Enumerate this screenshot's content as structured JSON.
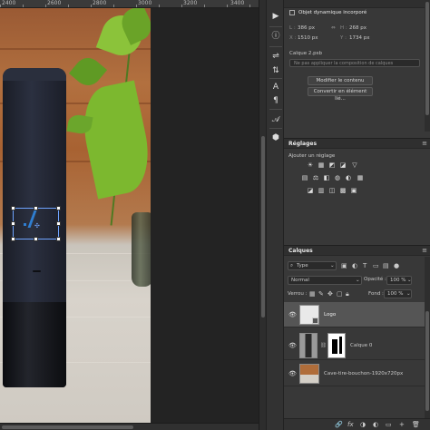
{
  "ruler": {
    "labels": [
      "2400",
      "2600",
      "2800",
      "3000",
      "3200",
      "3400"
    ]
  },
  "properties": {
    "object_type": "Objet dynamique incorporé",
    "l_label": "L :",
    "l_value": "386 px",
    "h_label": "H :",
    "h_value": "268 px",
    "x_label": "X :",
    "x_value": "1510 px",
    "y_label": "Y :",
    "y_value": "1734 px",
    "file_name": "Calque 2.psb",
    "comp_placeholder": "Ne pas appliquer la composition de calques",
    "edit_button": "Modifier le contenu",
    "convert_button": "Convertir en élément lié..."
  },
  "adjustments": {
    "title": "Réglages",
    "subtitle": "Ajouter un réglage",
    "icons": [
      "brightness-icon",
      "curves-icon",
      "levels-icon",
      "exposure-icon",
      "triangle-icon",
      "hue-icon",
      "balance-icon",
      "bw-icon",
      "photo-filter-icon",
      "channel-mixer-icon",
      "grid-icon",
      "invert-icon",
      "posterize-icon",
      "threshold-icon",
      "gradient-map-icon",
      "selective-color-icon"
    ],
    "glyphs": [
      "☀",
      "▦",
      "◩",
      "◪",
      "▽",
      "▤",
      "⚖",
      "◧",
      "◍",
      "◐",
      "▦",
      "◪",
      "▥",
      "◫",
      "▩",
      "▣"
    ]
  },
  "layers": {
    "title": "Calques",
    "filter_label": "Type",
    "blend_mode": "Normal",
    "opacity_label": "Opacité :",
    "opacity_value": "100 %",
    "lock_label": "Verrou :",
    "fill_label": "Fond :",
    "fill_value": "100 %",
    "items": [
      {
        "name": "Logo"
      },
      {
        "name": "Calque 0"
      },
      {
        "name": "Cave-tire-bouchon-1920x720px"
      }
    ]
  },
  "tools": [
    "▶",
    "ⓘ",
    "⇌",
    "⇅",
    "A",
    "¶",
    "𝒜",
    "⬢"
  ],
  "bottom_icons": [
    "🔗",
    "fx",
    "◑",
    "◐",
    "▭",
    "+",
    "🗑"
  ],
  "colors": {
    "accent": "#6fa4ff",
    "panel": "#383838",
    "canvas": "#232323"
  }
}
